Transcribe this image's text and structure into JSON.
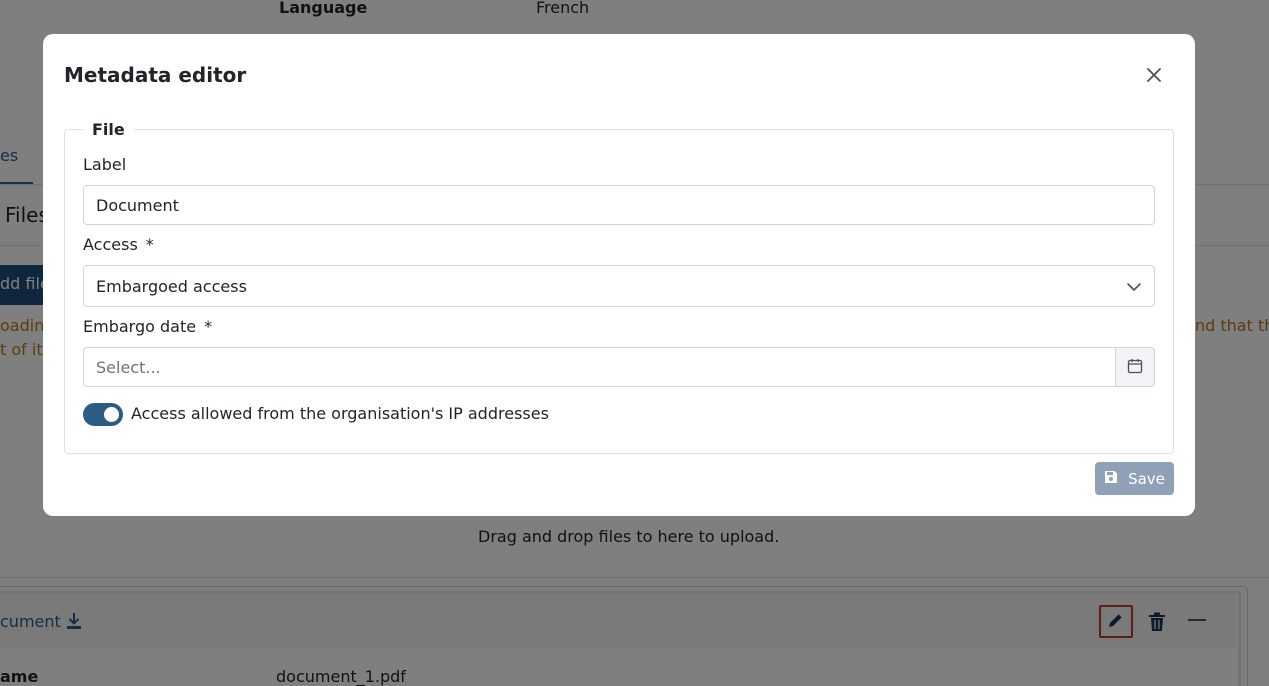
{
  "background": {
    "language_label": "Language",
    "language_value": "French",
    "tab_partial": "es",
    "files_heading": "Files",
    "add_files_button": "dd file",
    "warning_left_line1": "oading",
    "warning_left_line2": "t of its",
    "warning_right": "nd that th",
    "dropzone_text": "Drag and drop files to here to upload.",
    "file_card": {
      "title": "cument",
      "name_label": "ame",
      "name_value": "document_1.pdf"
    }
  },
  "modal": {
    "title": "Metadata editor",
    "fieldset_legend": "File",
    "label_field": {
      "label": "Label",
      "value": "Document"
    },
    "access_field": {
      "label": "Access",
      "required_mark": "*",
      "value": "Embargoed access"
    },
    "embargo_field": {
      "label": "Embargo date",
      "required_mark": "*",
      "placeholder": "Select..."
    },
    "ip_toggle": {
      "label": "Access allowed from the organisation's IP addresses",
      "checked": true
    },
    "save_label": "Save"
  },
  "colors": {
    "primary": "#1f4e79",
    "toggle_on": "#2c5b86",
    "save_disabled": "#8a9db3",
    "warning_text": "#b7791f",
    "highlight_border": "#c0392b"
  },
  "icons": {
    "close": "close-icon",
    "chevron": "chevron-down-icon",
    "calendar": "calendar-icon",
    "save": "save-icon",
    "download": "download-icon",
    "edit": "pencil-icon",
    "delete": "trash-icon",
    "collapse": "minus-icon"
  }
}
